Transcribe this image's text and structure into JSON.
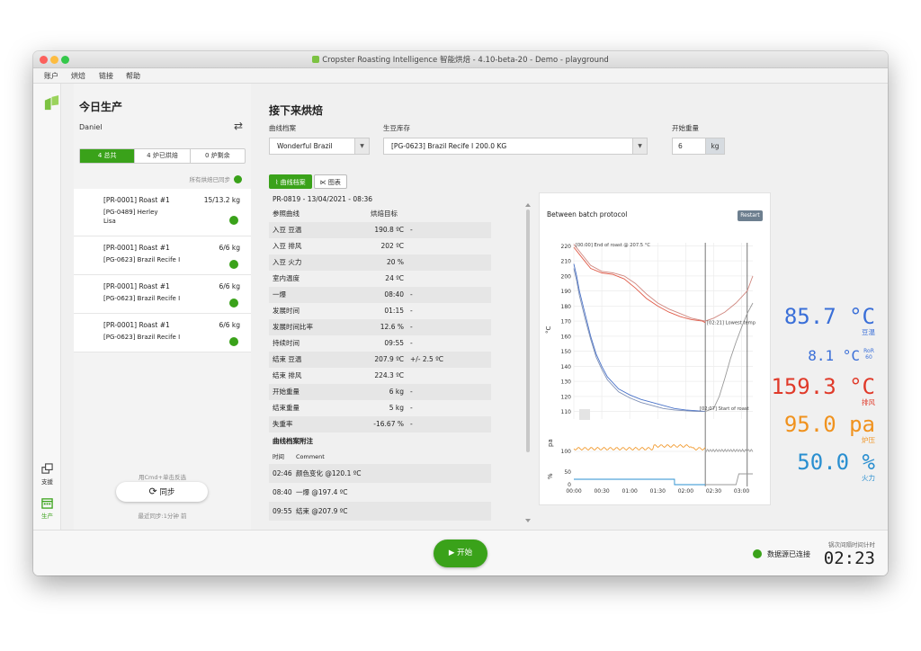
{
  "window": {
    "title": "Cropster Roasting Intelligence 智能烘焙 - 4.10-beta-20 - Demo - playground"
  },
  "menu": [
    "账户",
    "烘焙",
    "链接",
    "帮助"
  ],
  "nav": {
    "support_label": "支援",
    "production_label": "生产"
  },
  "production": {
    "title": "今日生产",
    "user": "Daniel",
    "segments": [
      "4 总共",
      "4 炉已烘焙",
      "0 炉剩余"
    ],
    "sync_status": "所有烘焙已同步",
    "roasts": [
      {
        "title": "[PR-0001] Roast #1",
        "weight": "15/13.2 kg",
        "green": "[PG-0489] Herley Lisa"
      },
      {
        "title": "[PR-0001] Roast #1",
        "weight": "6/6 kg",
        "green": "[PG-0623] Brazil Recife I"
      },
      {
        "title": "[PR-0001] Roast #1",
        "weight": "6/6 kg",
        "green": "[PG-0623] Brazil Recife I"
      },
      {
        "title": "[PR-0001] Roast #1",
        "weight": "6/6 kg",
        "green": "[PG-0623] Brazil Recife I"
      }
    ],
    "refresh_hint": "用Cmd+单击反选",
    "sync_label": "同步",
    "last_sync": "最近同步:1分钟 前"
  },
  "next": {
    "title": "接下来烘焙",
    "profile_label": "曲线档案",
    "profile_value": "Wonderful Brazil",
    "stock_label": "生豆库存",
    "stock_value": "[PG-0623] Brazil Recife I 200.0 KG",
    "weight_label": "开始重量",
    "weight_value": "6",
    "weight_unit": "kg",
    "tab_profile": "曲线档案",
    "tab_chart": "图表"
  },
  "profile_table": {
    "header": "PR-0819 - 13/04/2021 - 08:36",
    "col1": "参照曲线",
    "col2": "烘焙目标",
    "rows": [
      {
        "label": "入豆 豆温",
        "value": "190.8 ºC",
        "extra": "-"
      },
      {
        "label": "入豆 排风",
        "value": "202 ºC",
        "extra": ""
      },
      {
        "label": "入豆 火力",
        "value": "20 %",
        "extra": ""
      },
      {
        "label": "室内温度",
        "value": "24 ºC",
        "extra": ""
      },
      {
        "label": "一爆",
        "value": "08:40",
        "extra": "-"
      },
      {
        "label": "发展时间",
        "value": "01:15",
        "extra": "-"
      },
      {
        "label": "发展时间比率",
        "value": "12.6 %",
        "extra": "-"
      },
      {
        "label": "持续时间",
        "value": "09:55",
        "extra": "-"
      },
      {
        "label": "结束 豆温",
        "value": "207.9 ºC",
        "extra": "+/- 2.5 ºC"
      },
      {
        "label": "结束 排风",
        "value": "224.3 ºC",
        "extra": ""
      },
      {
        "label": "开始重量",
        "value": "6 kg",
        "extra": "-"
      },
      {
        "label": "结束重量",
        "value": "5 kg",
        "extra": "-"
      },
      {
        "label": "失重率",
        "value": "-16.67 %",
        "extra": "-"
      }
    ],
    "notes_title": "曲线档案附注",
    "notes_col1": "时间",
    "notes_col2": "Comment",
    "notes": [
      {
        "time": "02:46",
        "text": "颜色变化 @120.1 ºC"
      },
      {
        "time": "08:40",
        "text": "一爆 @197.4 ºC"
      },
      {
        "time": "09:55",
        "text": "结束 @207.9 ºC"
      }
    ]
  },
  "chart_card": {
    "title": "Between batch protocol",
    "restart": "Restart"
  },
  "chart_data": {
    "type": "line",
    "ylabel": "°C",
    "ylim": [
      105,
      222
    ],
    "yticks": [
      110,
      120,
      130,
      140,
      150,
      160,
      170,
      180,
      190,
      200,
      210,
      220
    ],
    "xlim": [
      0,
      3.2
    ],
    "xticks": [
      {
        "v": 0,
        "l": "00:00"
      },
      {
        "v": 0.5,
        "l": "00:30"
      },
      {
        "v": 1,
        "l": "01:00"
      },
      {
        "v": 1.5,
        "l": "01:30"
      },
      {
        "v": 2,
        "l": "02:00"
      },
      {
        "v": 2.5,
        "l": "02:30"
      },
      {
        "v": 3,
        "l": "03:00"
      }
    ],
    "pa_label": "pa",
    "pa_tick": "100",
    "pct_label": "%",
    "pct_ticks": [
      "50",
      "0"
    ],
    "annotations": [
      {
        "text": "[00:00] End of roast @ 207.5 °C",
        "x": 0.03,
        "y": 219.5
      },
      {
        "text": "[02:21] Lowest temp",
        "x": 2.38,
        "y": 168
      },
      {
        "text": "[02:07] Start of roast",
        "x": 2.25,
        "y": 111
      }
    ],
    "vlines": [
      2.35,
      3.1
    ],
    "series": [
      {
        "color": "#e05a47",
        "x": [
          0,
          0.15,
          0.3,
          0.5,
          0.7,
          0.9,
          1.1,
          1.3,
          1.5,
          1.7,
          1.9,
          2.1,
          2.3,
          2.35
        ],
        "y": [
          219,
          212,
          205,
          202,
          201,
          198,
          192,
          185,
          180,
          176,
          173,
          171,
          170,
          169
        ]
      },
      {
        "color": "#d08880",
        "x": [
          0,
          0.15,
          0.3,
          0.5,
          0.7,
          0.9,
          1.1,
          1.3,
          1.5,
          1.7,
          1.9,
          2.1,
          2.35,
          2.5,
          2.7,
          2.9,
          3.1,
          3.2
        ],
        "y": [
          221,
          214,
          207,
          203,
          202,
          200,
          195,
          188,
          182,
          178,
          175,
          172,
          170,
          172,
          176,
          182,
          190,
          200
        ]
      },
      {
        "color": "#4a73c9",
        "x": [
          0,
          0.05,
          0.1,
          0.2,
          0.3,
          0.4,
          0.5,
          0.6,
          0.8,
          1.0,
          1.2,
          1.4,
          1.6,
          1.8,
          2.0,
          2.2,
          2.35
        ],
        "y": [
          208,
          200,
          190,
          175,
          160,
          148,
          140,
          133,
          125,
          121,
          118,
          116,
          114,
          112,
          111,
          110.5,
          110
        ]
      },
      {
        "color": "#7e8fb5",
        "x": [
          0,
          0.05,
          0.1,
          0.2,
          0.3,
          0.4,
          0.5,
          0.6,
          0.8,
          1.0,
          1.2,
          1.4,
          1.6,
          1.8,
          2.0,
          2.2,
          2.35
        ],
        "y": [
          205,
          197,
          187,
          172,
          158,
          146,
          138,
          131,
          123,
          119,
          116,
          114,
          112,
          111,
          110.5,
          110,
          110
        ]
      },
      {
        "color": "#999999",
        "x": [
          2.35,
          2.5,
          2.6,
          2.7,
          2.8,
          2.9,
          3.0,
          3.1,
          3.2
        ],
        "y": [
          110,
          112,
          120,
          132,
          145,
          156,
          166,
          175,
          182
        ]
      }
    ]
  },
  "readings": [
    {
      "value": "85.7 °C",
      "label": "豆温",
      "color": "#3a6fd8"
    },
    {
      "value": "8.1 °C",
      "label": "RoR 60",
      "color": "#3a6fd8"
    },
    {
      "value": "159.3 °C",
      "label": "排风",
      "color": "#e03a2a"
    },
    {
      "value": "95.0 pa",
      "label": "炉压",
      "color": "#f0921e"
    },
    {
      "value": "50.0 %",
      "label": "火力",
      "color": "#2a8fd0"
    }
  ],
  "footer": {
    "start": "开始",
    "connection": "数据源已连接",
    "timer_label": "锅次间隔时间计时",
    "timer": "02:23"
  }
}
